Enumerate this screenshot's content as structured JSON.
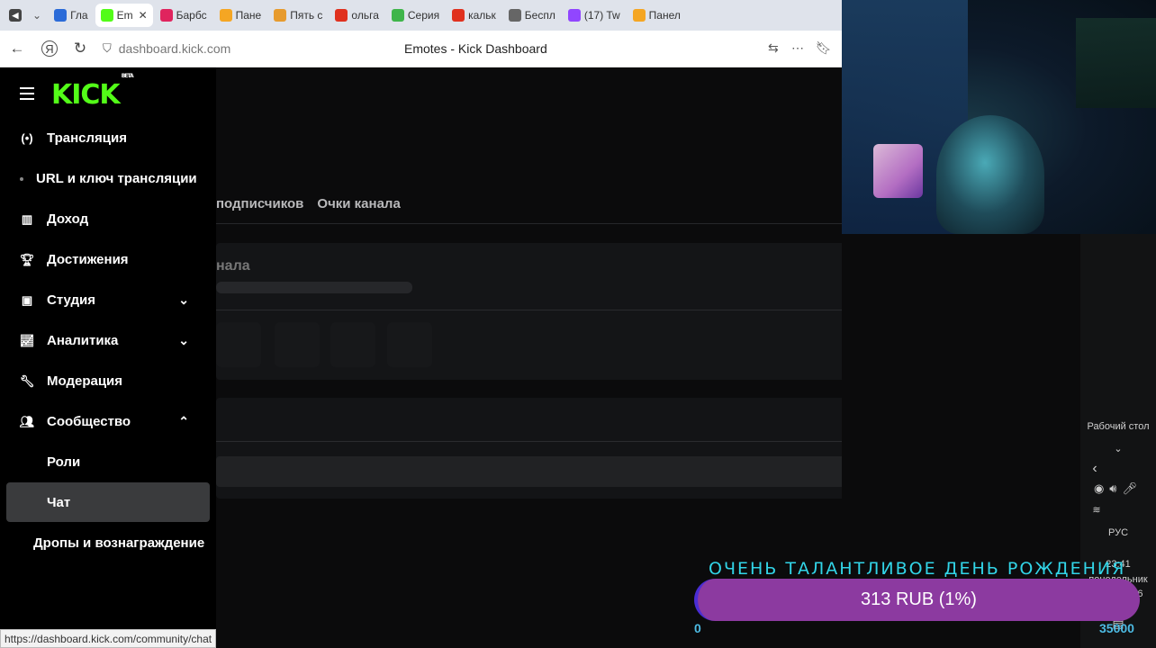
{
  "browser": {
    "tabs": [
      {
        "label": "Гла",
        "color": "#2b6bd8",
        "icon": "play-icon"
      },
      {
        "label": "Em",
        "color": "#53fc18",
        "icon": "kick-icon",
        "active": true
      },
      {
        "label": "Барбс",
        "color": "#e0245e",
        "icon": "video-icon"
      },
      {
        "label": "Пане",
        "color": "#f5a623",
        "icon": "d-icon"
      },
      {
        "label": "Пять с",
        "color": "#e79b2e",
        "icon": "page-icon"
      },
      {
        "label": "ольга",
        "color": "#e0311e",
        "icon": "yandex-icon"
      },
      {
        "label": "Серия",
        "color": "#3fb54a",
        "icon": "hd-icon"
      },
      {
        "label": "кальк",
        "color": "#e0311e",
        "icon": "yandex-icon"
      },
      {
        "label": "Беспл",
        "color": "#666666",
        "icon": "doc-icon"
      },
      {
        "label": "(17) Tw",
        "color": "#9146ff",
        "icon": "twitch-icon"
      },
      {
        "label": "Панел",
        "color": "#f5a623",
        "icon": "d-icon"
      }
    ],
    "url": "dashboard.kick.com",
    "page_title": "Emotes - Kick Dashboard"
  },
  "sidebar": {
    "logo": "KICK",
    "logo_badge": "BETA",
    "items": [
      {
        "label": "Трансляция",
        "icon": "broadcast-icon"
      },
      {
        "label": "URL и ключ трансляции"
      },
      {
        "label": "Доход",
        "icon": "chart-icon"
      },
      {
        "label": "Достижения",
        "icon": "trophy-icon"
      },
      {
        "label": "Студия",
        "icon": "studio-icon"
      },
      {
        "label": "Аналитика",
        "icon": "analytics-icon"
      },
      {
        "label": "Модерация",
        "icon": "wrench-icon"
      },
      {
        "label": "Сообщество",
        "icon": "community-icon"
      },
      {
        "label": "Роли"
      },
      {
        "label": "Чат"
      },
      {
        "label": "Дропы и вознаграждение"
      }
    ]
  },
  "main": {
    "tabs": [
      "подписчиков",
      "Очки канала"
    ],
    "card_title": "нала"
  },
  "taskbar": {
    "desktop_label": "Рабочий стол",
    "lang": "РУС",
    "time": "23:41",
    "weekday": "понедельник",
    "date": "03.08.2026"
  },
  "overlay": {
    "banner": "ОЧЕНЬ ТАЛАНТЛИВОЕ ДЕНЬ РОЖДЕНИЯ",
    "donation_text": "313 RUB (1%)",
    "progress_fraction": 0.01,
    "min": "0",
    "max": "35000"
  },
  "status_url": "https://dashboard.kick.com/community/chat"
}
